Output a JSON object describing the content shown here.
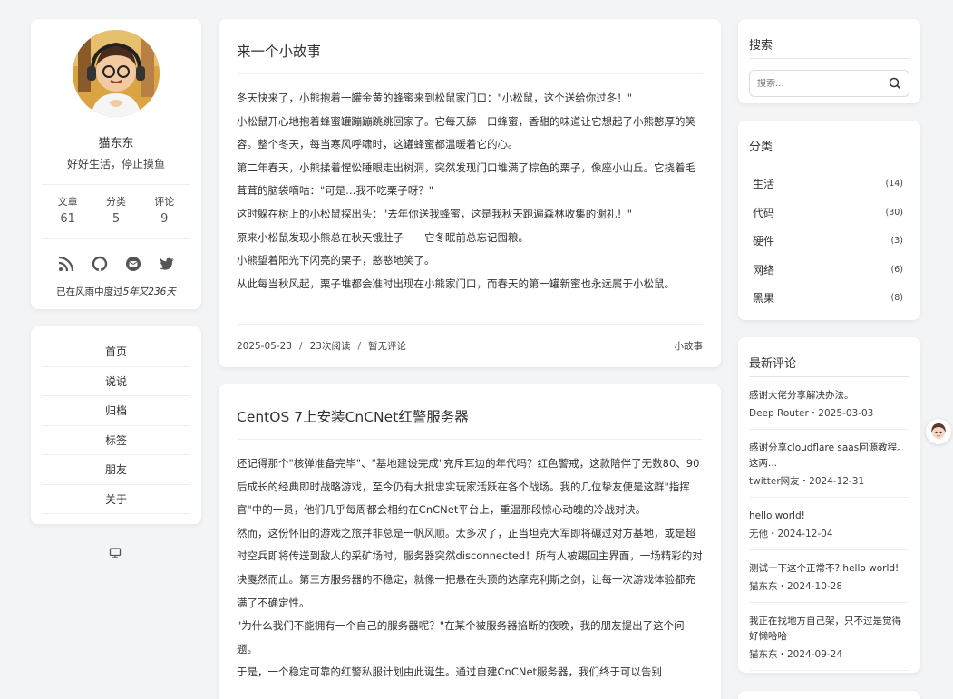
{
  "profile": {
    "name": "猫东东",
    "motto": "好好生活，停止摸鱼",
    "stats": [
      {
        "label": "文章",
        "value": "61"
      },
      {
        "label": "分类",
        "value": "5"
      },
      {
        "label": "评论",
        "value": "9"
      }
    ],
    "socials": [
      "rss-icon",
      "github-icon",
      "email-icon",
      "twitter-icon"
    ],
    "runtime_prefix": "已在风雨中度过",
    "runtime": "5年又236天"
  },
  "nav": {
    "items": [
      "首页",
      "说说",
      "归档",
      "标签",
      "朋友",
      "关于"
    ]
  },
  "articles": [
    {
      "title": "来一个小故事",
      "paragraphs": [
        "冬天快来了，小熊抱着一罐金黄的蜂蜜来到松鼠家门口：\"小松鼠，这个送给你过冬！\"",
        "小松鼠开心地抱着蜂蜜罐蹦蹦跳跳回家了。它每天舔一口蜂蜜，香甜的味道让它想起了小熊憨厚的笑容。整个冬天，每当寒风呼啸时，这罐蜂蜜都温暖着它的心。",
        "第二年春天，小熊揉着惺忪睡眼走出树洞，突然发现门口堆满了棕色的栗子，像座小山丘。它挠着毛茸茸的脑袋嘀咕：\"可是...我不吃栗子呀？\"",
        "这时躲在树上的小松鼠探出头：\"去年你送我蜂蜜，这是我秋天跑遍森林收集的谢礼！\"",
        "原来小松鼠发现小熊总在秋天饿肚子——它冬眠前总忘记囤粮。",
        "小熊望着阳光下闪亮的栗子，憨憨地笑了。",
        "从此每当秋风起，栗子堆都会准时出现在小熊家门口，而春天的第一罐新蜜也永远属于小松鼠。"
      ],
      "date": "2025-05-23",
      "views": "23次阅读",
      "comments": "暂无评论",
      "category": "小故事"
    },
    {
      "title": "CentOS 7上安装CnCNet红警服务器",
      "paragraphs": [
        "还记得那个\"核弹准备完毕\"、\"基地建设完成\"充斥耳边的年代吗？红色警戒，这款陪伴了无数80、90后成长的经典即时战略游戏，至今仍有大批忠实玩家活跃在各个战场。我的几位挚友便是这群\"指挥官\"中的一员，他们几乎每周都会相约在CnCNet平台上，重温那段惊心动魄的冷战对决。",
        "然而，这份怀旧的游戏之旅并非总是一帆风顺。太多次了，正当坦克大军即将碾过对方基地，或是超时空兵即将传送到敌人的采矿场时，服务器突然disconnected！所有人被踢回主界面，一场精彩的对决戛然而止。第三方服务器的不稳定，就像一把悬在头顶的达摩克利斯之剑，让每一次游戏体验都充满了不确定性。",
        "\"为什么我们不能拥有一个自己的服务器呢？\"在某个被服务器掐断的夜晚，我的朋友提出了这个问题。",
        "于是，一个稳定可靠的红警私服计划由此诞生。通过自建CnCNet服务器，我们终于可以告别"
      ]
    }
  ],
  "search": {
    "title": "搜索",
    "placeholder": "搜索..."
  },
  "categories": {
    "title": "分类",
    "items": [
      {
        "name": "生活",
        "count": "(14)"
      },
      {
        "name": "代码",
        "count": "(30)"
      },
      {
        "name": "硬件",
        "count": "(3)"
      },
      {
        "name": "网络",
        "count": "(6)"
      },
      {
        "name": "黑果",
        "count": "(8)"
      }
    ]
  },
  "recent_comments": {
    "title": "最新评论",
    "items": [
      {
        "text": "感谢大佬分享解决办法。",
        "meta": "Deep Router・2025-03-03"
      },
      {
        "text": "感谢分享cloudflare saas回源教程。 这两...",
        "meta": "twitter网友・2024-12-31"
      },
      {
        "text": "hello world!",
        "meta": "无他・2024-12-04"
      },
      {
        "text": "测试一下这个正常不? hello world!",
        "meta": "猫东东・2024-10-28"
      },
      {
        "text": "我正在找地方自己架，只不过是觉得好懒哈哈",
        "meta": "猫东东・2024-09-24"
      }
    ]
  },
  "colors": {
    "background": "#f3f4f6",
    "card": "#ffffff",
    "text": "#333333"
  }
}
